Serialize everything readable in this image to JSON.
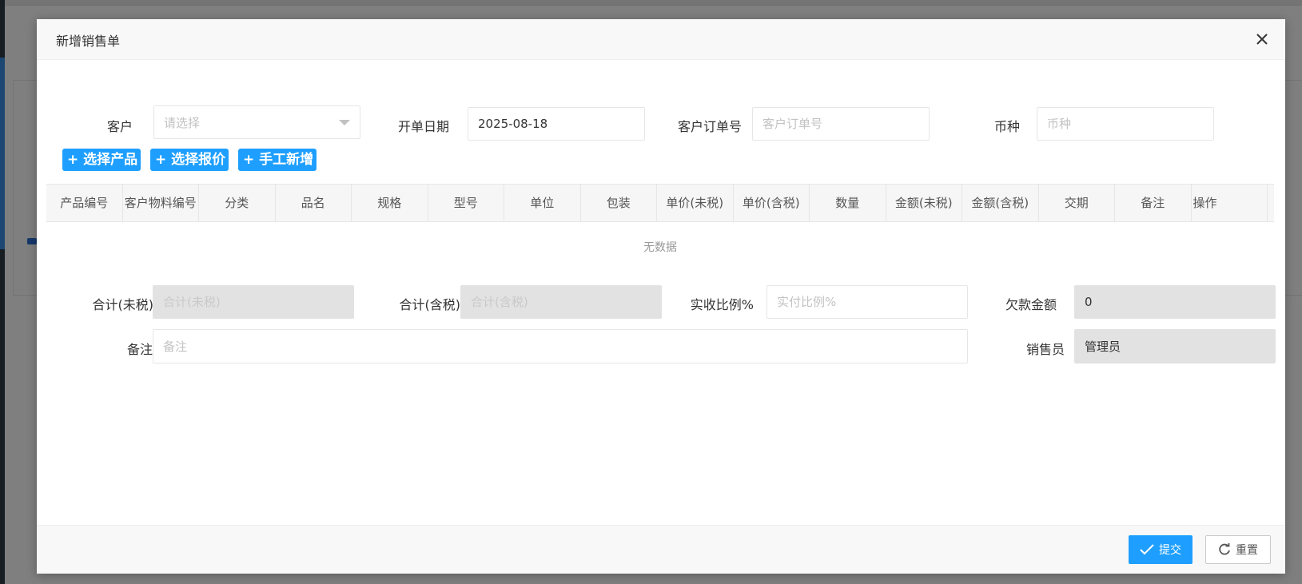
{
  "dialog": {
    "title": "新增销售单"
  },
  "form": {
    "customer_label": "客户",
    "customer_placeholder": "请选择",
    "order_date_label": "开单日期",
    "order_date_value": "2025-08-18",
    "customer_po_label": "客户订单号",
    "customer_po_placeholder": "客户订单号",
    "currency_label": "币种",
    "currency_placeholder": "币种",
    "total_no_tax_label": "合计(未税)",
    "total_no_tax_placeholder": "合计(未税)",
    "total_tax_label": "合计(含税)",
    "total_tax_placeholder": "合计(含税)",
    "received_ratio_label": "实收比例%",
    "received_ratio_placeholder": "实付比例%",
    "arrears_label": "欠款金额",
    "arrears_value": "0",
    "remark_label": "备注",
    "remark_placeholder": "备注",
    "salesperson_label": "销售员",
    "salesperson_value": "管理员"
  },
  "toolbar": {
    "select_product": "+ 选择产品",
    "select_quote": "+ 选择报价",
    "manual_add": "+ 手工新增"
  },
  "table": {
    "columns": [
      "产品编号",
      "客户物料编号",
      "分类",
      "品名",
      "规格",
      "型号",
      "单位",
      "包装",
      "单价(未税)",
      "单价(含税)",
      "数量",
      "金额(未税)",
      "金额(含税)",
      "交期",
      "备注",
      "操作"
    ],
    "empty_text": "无数据"
  },
  "footer": {
    "submit_label": "提交",
    "reset_label": "重置"
  },
  "colors": {
    "primary": "#1e9fff",
    "disabled_bg": "#e2e2e2"
  }
}
